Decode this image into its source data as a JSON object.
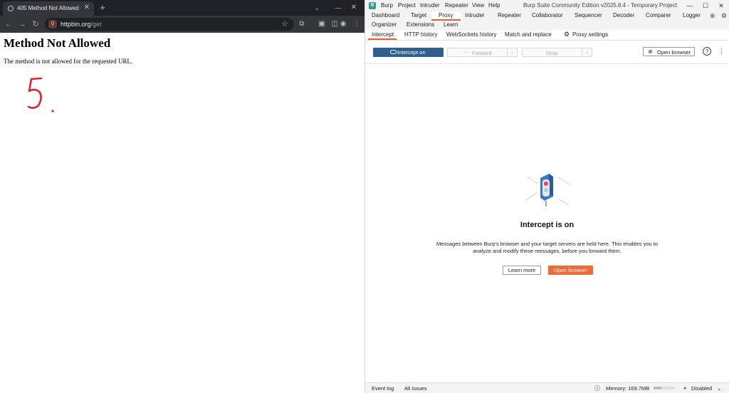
{
  "chrome": {
    "tab_title": "405 Method Not Allowed",
    "url_host": "httpbin.org",
    "url_path": "/get"
  },
  "page": {
    "heading": "Method Not Allowed",
    "message": "The method is not allowed for the requested URL.",
    "annotation": "5."
  },
  "burp": {
    "menu": [
      "Burp",
      "Project",
      "Intruder",
      "Repeater",
      "View",
      "Help"
    ],
    "window_title": "Burp Suite Community Edition v2025.8.4 - Temporary Project",
    "main_tabs_row1": [
      "Dashboard",
      "Target",
      "Proxy",
      "Intruder",
      "Repeater",
      "Collaborator",
      "Sequencer",
      "Decoder",
      "Comparer",
      "Logger"
    ],
    "main_tabs_row2": [
      "Organizer",
      "Extensions",
      "Learn"
    ],
    "active_tab": "Proxy",
    "sub_tabs": [
      "Intercept",
      "HTTP history",
      "WebSockets history",
      "Match and replace",
      "Proxy settings"
    ],
    "active_sub_tab": "Intercept",
    "buttons": {
      "intercept": "Intercept on",
      "forward": "Forward",
      "drop": "Drop",
      "open_browser": "Open browser",
      "help": "?"
    },
    "intercept_panel": {
      "heading": "Intercept is on",
      "message_line1": "Messages between Burp's browser and your target servers are held here. This enables you to",
      "message_line2": "analyze and modify these messages, before you forward them.",
      "learn_more": "Learn more",
      "open_browser": "Open browser"
    },
    "status": {
      "event_log": "Event log",
      "all_issues": "All issues",
      "memory": "Memory: 169.7MB",
      "memory_fraction": 0.35,
      "disabled": "Disabled"
    }
  },
  "colors": {
    "chrome_dark": "#202124",
    "burp_accent": "#e8602c",
    "intercept_button": "#2e5f8f",
    "open_browser_button": "#f26a3a",
    "annotation_red": "#e0202e"
  }
}
